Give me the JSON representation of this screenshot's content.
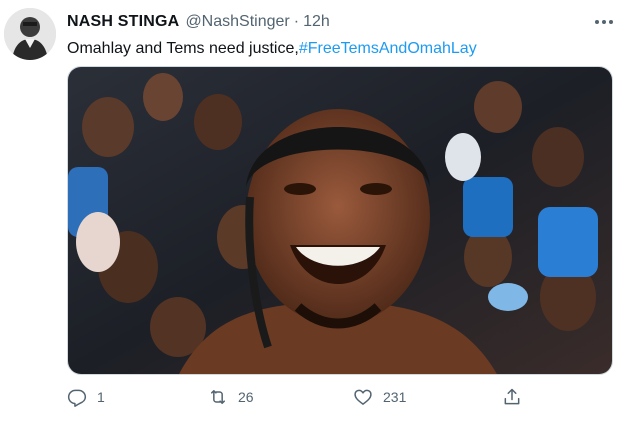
{
  "tweet": {
    "display_name": "NASH STINGA",
    "handle": "@NashStinger",
    "separator": "·",
    "time": "12h",
    "text": "Omahlay and Tems need justice,",
    "hashtag": "#FreeTemsAndOmahLay",
    "counts": {
      "replies": "1",
      "retweets": "26",
      "likes": "231"
    }
  },
  "icons": {
    "more": "more-horizontal-icon",
    "reply": "reply-icon",
    "retweet": "retweet-icon",
    "like": "heart-icon",
    "share": "share-icon"
  },
  "colors": {
    "text": "#0f1419",
    "secondary": "#536471",
    "link": "#1d9bf0",
    "border": "#cfd9de"
  }
}
